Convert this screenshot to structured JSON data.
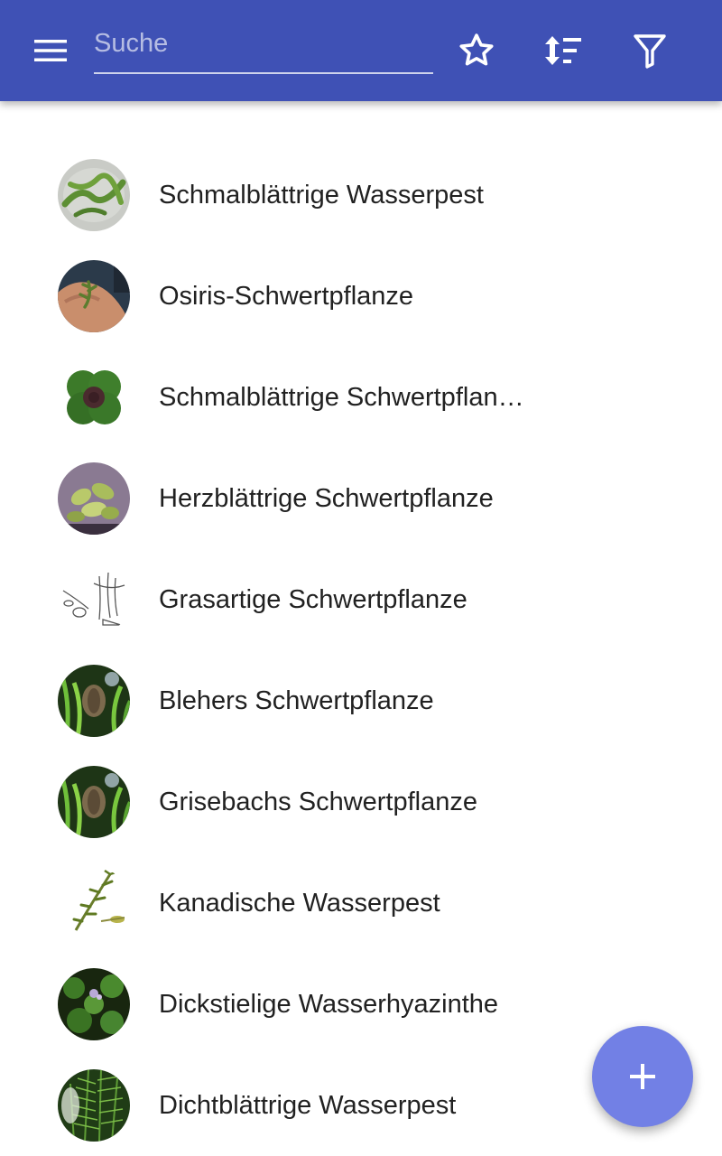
{
  "toolbar": {
    "menu_icon": "menu-icon",
    "search_placeholder": "Suche",
    "search_value": "",
    "favorites_icon": "star-outline-icon",
    "sort_icon": "sort-icon",
    "filter_icon": "filter-icon",
    "color": "#3f51b5"
  },
  "plants": [
    {
      "name": "Schmalblättrige Wasserpest"
    },
    {
      "name": "Osiris-Schwertpflanze"
    },
    {
      "name": "Schmalblättrige Schwertpflan…"
    },
    {
      "name": "Herzblättrige Schwertpflanze"
    },
    {
      "name": "Grasartige Schwertpflanze"
    },
    {
      "name": "Blehers Schwertpflanze"
    },
    {
      "name": "Grisebachs Schwertpflanze"
    },
    {
      "name": "Kanadische Wasserpest"
    },
    {
      "name": "Dickstielige Wasserhyazinthe"
    },
    {
      "name": "Dichtblättrige Wasserpest"
    }
  ],
  "fab": {
    "icon": "plus-icon",
    "color": "#7280e5"
  }
}
